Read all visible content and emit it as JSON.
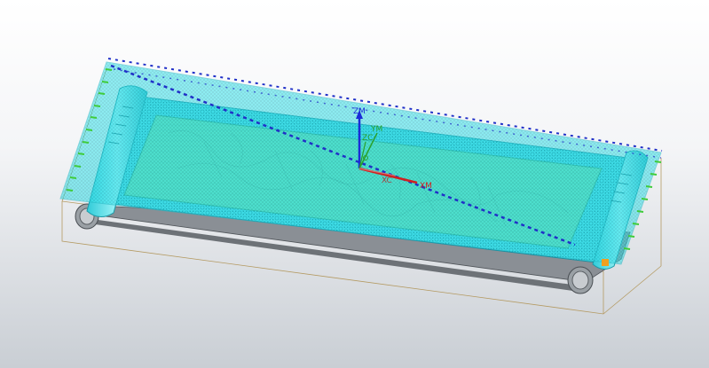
{
  "viewport": {
    "background_top": "#ffffff",
    "background_bottom": "#c9ced4"
  },
  "model": {
    "description_colors": {
      "surface": "#33e0e8",
      "surface_mesh": "#1aa8b4",
      "relief_panel": "#5fd9a8",
      "frame": "#6fe6f0",
      "base": "#7a7f84",
      "bounding_box": "#b49a62",
      "projection_dashes": "#2030c8",
      "edge_marks": "#3fcc3a"
    }
  },
  "csys": {
    "labels": {
      "zm": "ZM",
      "ym": "YM",
      "zc": "ZC",
      "xc": "XC",
      "xm": "XM"
    },
    "colors": {
      "zm": "#1a2bd8",
      "ym": "#2aa02a",
      "xm": "#d02020"
    }
  }
}
